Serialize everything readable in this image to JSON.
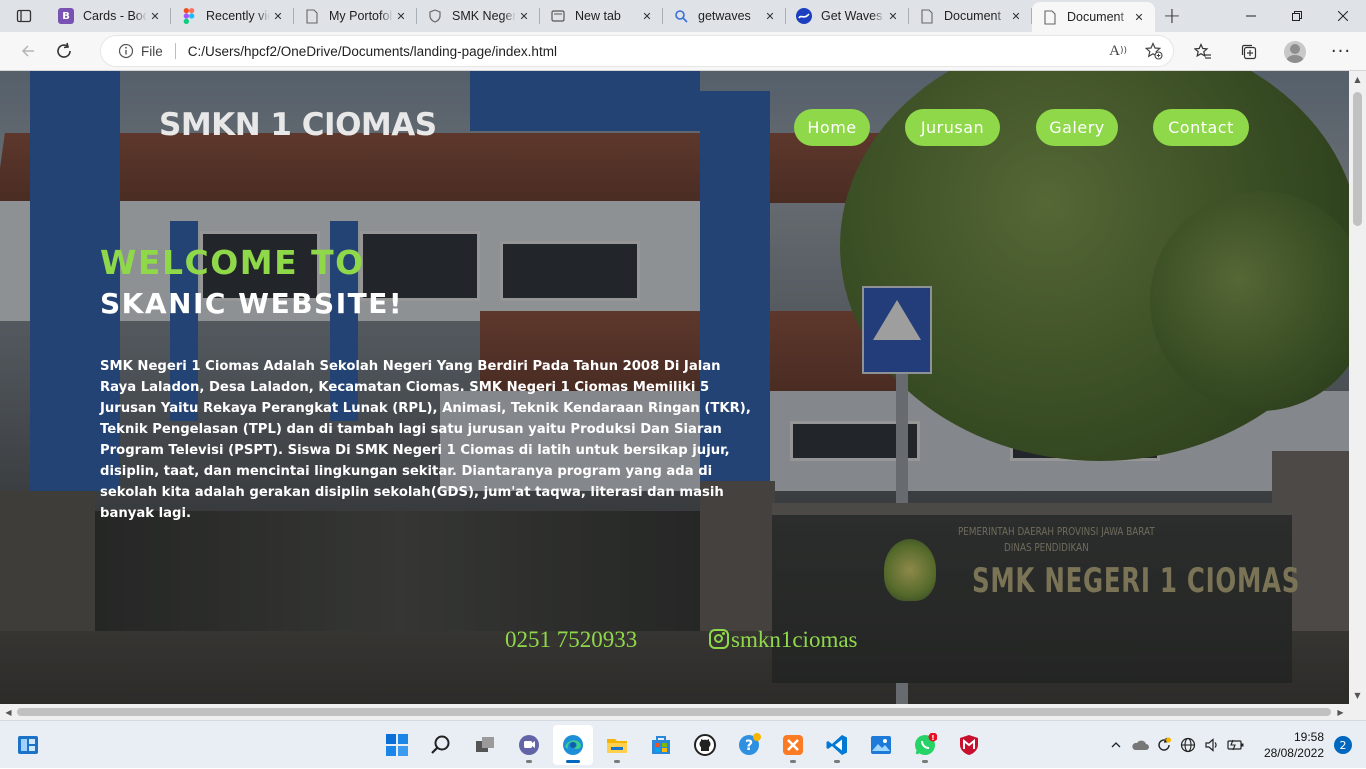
{
  "browser": {
    "tabs": [
      {
        "title": "Cards - Bootstrap",
        "favicon": "bootstrap-icon",
        "color": "#7952b3"
      },
      {
        "title": "Recently viewed",
        "favicon": "figma-icon",
        "color": "#f24e1e"
      },
      {
        "title": "My Portofolio",
        "favicon": "page-icon",
        "color": "#666666"
      },
      {
        "title": "SMK Negeri",
        "favicon": "shield-icon",
        "color": "#666666"
      },
      {
        "title": "New tab",
        "favicon": "newtab-icon",
        "color": "#555555"
      },
      {
        "title": "getwaves",
        "favicon": "search-icon",
        "color": "#3a6fd8"
      },
      {
        "title": "Get Waves",
        "favicon": "waves-icon",
        "color": "#1d3fbf"
      },
      {
        "title": "Document",
        "favicon": "page-icon",
        "color": "#666666"
      },
      {
        "title": "Document",
        "favicon": "page-icon",
        "color": "#666666",
        "active": true
      }
    ],
    "address": {
      "scheme_label": "File",
      "url": "C:/Users/hpcf2/OneDrive/Documents/landing-page/index.html"
    }
  },
  "page": {
    "brand": "SMKN 1 CIOMAS",
    "nav": [
      "Home",
      "Jurusan",
      "Galery",
      "Contact"
    ],
    "heading_line1": "WELCOME TO",
    "heading_line2": "SKANIC WEBSITE!",
    "description": "SMK Negeri 1 Ciomas Adalah Sekolah Negeri Yang Berdiri Pada Tahun 2008 Di Jalan Raya Laladon, Desa Laladon, Kecamatan Ciomas. SMK Negeri 1 Ciomas Memiliki 5 Jurusan Yaitu Rekaya Perangkat Lunak (RPL), Animasi, Teknik Kendaraan Ringan (TKR), Teknik Pengelasan (TPL) dan di tambah lagi satu jurusan yaitu Produksi Dan Siaran Program Televisi (PSPT). Siswa Di SMK Negeri 1 Ciomas di latih untuk bersikap jujur, disiplin, taat, dan mencintai lingkungan sekitar. Diantaranya program yang ada di sekolah kita adalah gerakan disiplin sekolah(GDS), jum'at taqwa, literasi dan masih banyak lagi.",
    "phone": "0251 7520933",
    "instagram": "smkn1ciomas",
    "photo_sign": {
      "top_text": "PEMERINTAH DAERAH PROVINSI JAWA BARAT",
      "sub_text": "DINAS PENDIDIKAN",
      "school_name": "SMK NEGERI 1 CIOMAS"
    },
    "accent_color": "#8fd84a"
  },
  "taskbar": {
    "time": "19:58",
    "date": "28/08/2022",
    "notification_count": "2"
  }
}
